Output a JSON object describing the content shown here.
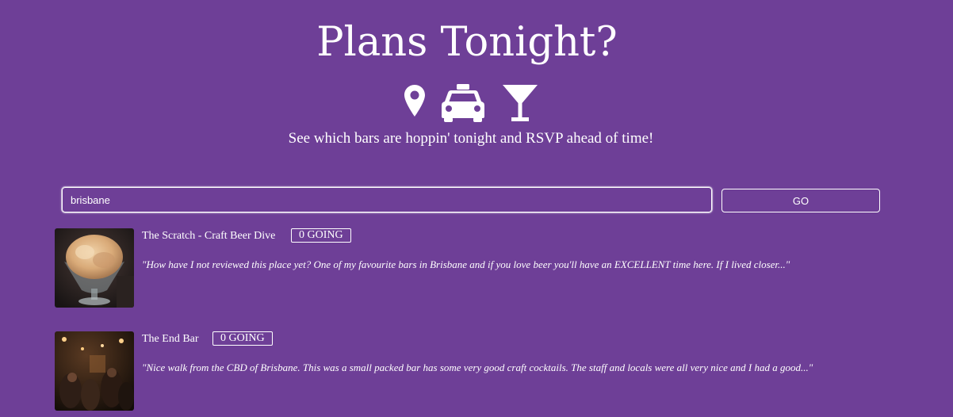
{
  "header": {
    "title": "Plans Tonight?",
    "subtitle": "See which bars are hoppin' tonight and RSVP ahead of time!",
    "icons": [
      "map-marker-icon",
      "taxi-icon",
      "cocktail-icon"
    ]
  },
  "search": {
    "value": "brisbane",
    "button_label": "GO"
  },
  "results": [
    {
      "name": "The Scratch - Craft Beer Dive",
      "going_label": "0 GOING",
      "snippet": "\"How have I not reviewed this place yet? One of my favourite bars in Brisbane and if you love beer you'll have an EXCELLENT time here. If I lived closer...\""
    },
    {
      "name": "The End Bar",
      "going_label": "0 GOING",
      "snippet": "\"Nice walk from the CBD of Brisbane. This was a small packed bar has some very good craft cocktails. The staff and locals were all very nice and I had a good...\""
    }
  ],
  "colors": {
    "background": "#6e3f97",
    "foreground": "#ffffff"
  }
}
